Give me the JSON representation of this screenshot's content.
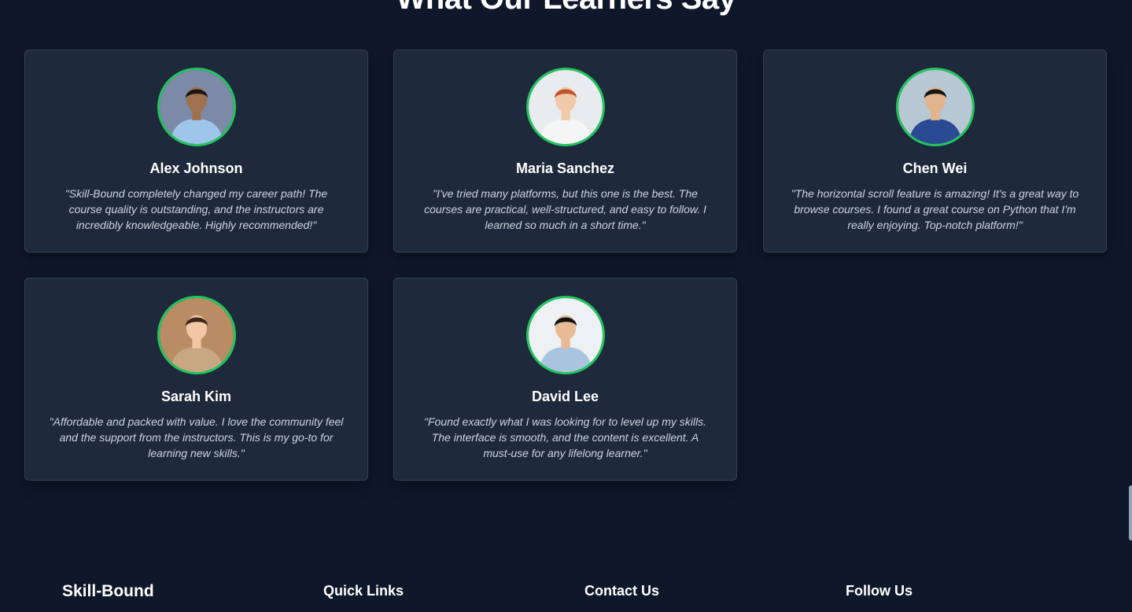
{
  "section": {
    "title": "What Our Learners Say"
  },
  "testimonials": [
    {
      "name": "Alex Johnson",
      "quote": "\"Skill-Bound completely changed my career path! The course quality is outstanding, and the instructors are incredibly knowledgeable. Highly recommended!\"",
      "photo": {
        "bg": "#7c8aa8",
        "skin": "#a0714f",
        "hair": "#1f1611",
        "shirt": "#9ec5ea"
      }
    },
    {
      "name": "Maria Sanchez",
      "quote": "\"I've tried many platforms, but this one is the best. The courses are practical, well-structured, and easy to follow. I learned so much in a short time.\"",
      "photo": {
        "bg": "#e8ecef",
        "skin": "#f0c9a8",
        "hair": "#c0562a",
        "shirt": "#f5f5f5"
      }
    },
    {
      "name": "Chen Wei",
      "quote": "\"The horizontal scroll feature is amazing! It's a great way to browse courses. I found a great course on Python that I'm really enjoying. Top-notch platform!\"",
      "photo": {
        "bg": "#b7c7d3",
        "skin": "#e2b48b",
        "hair": "#151515",
        "shirt": "#2a4a93"
      }
    },
    {
      "name": "Sarah Kim",
      "quote": "\"Affordable and packed with value. I love the community feel and the support from the instructors. This is my go-to for learning new skills.\"",
      "photo": {
        "bg": "#b98c63",
        "skin": "#f1c7a4",
        "hair": "#3d261a",
        "shirt": "#c7a883"
      }
    },
    {
      "name": "David Lee",
      "quote": "\"Found exactly what I was looking for to level up my skills. The interface is smooth, and the content is excellent. A must-use for any lifelong learner.\"",
      "photo": {
        "bg": "#eef1f3",
        "skin": "#e7bb93",
        "hair": "#111111",
        "shirt": "#a9c4de"
      }
    }
  ],
  "footer": {
    "brand": "Skill-Bound",
    "quick_links": "Quick Links",
    "contact": "Contact Us",
    "follow": "Follow Us"
  },
  "colors": {
    "background": "#0f172a",
    "card": "#1e293b",
    "card_border": "#334155",
    "avatar_ring": "#22c55e",
    "quote_text": "#cbd5e1"
  }
}
